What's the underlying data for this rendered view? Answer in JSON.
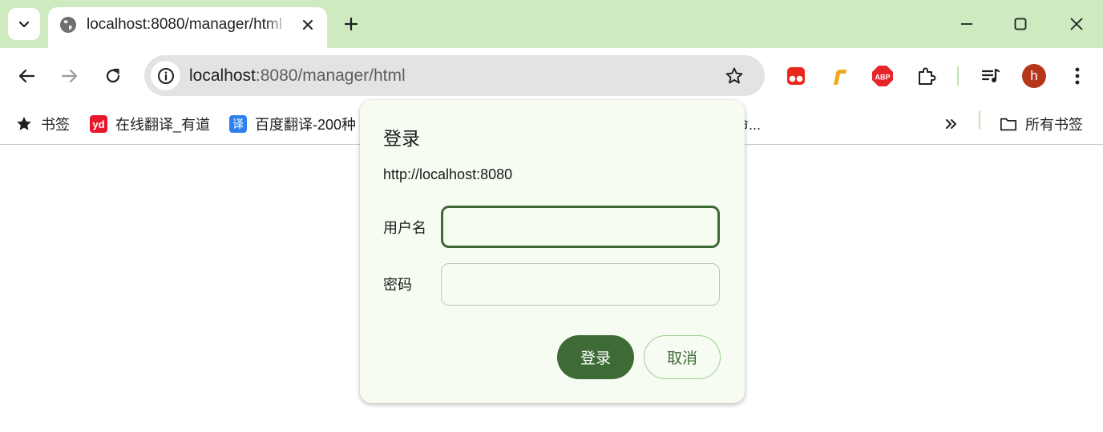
{
  "tab": {
    "title": "localhost:8080/manager/html",
    "close_icon": "close-icon",
    "favicon": "globe-icon"
  },
  "new_tab_symbol": "+",
  "address_bar": {
    "host": "localhost",
    "rest": ":8080/manager/html"
  },
  "avatar_letter": "h",
  "extensions": [
    "tampermonkey-icon",
    "pencil-extension-icon",
    "adblock-plus-icon",
    "puzzle-icon",
    "media-queue-icon"
  ],
  "bookmarks": {
    "star_label": "书签",
    "items": [
      {
        "label": "在线翻译_有道",
        "icon_text": "yd",
        "icon_color": "#e8172c"
      },
      {
        "label": "百度翻译-200种",
        "icon_text": "译",
        "icon_color": "#2f80ed"
      }
    ],
    "hidden_fragment": "命...",
    "all_bookmarks_label": "所有书签"
  },
  "dialog": {
    "title": "登录",
    "origin": "http://localhost:8080",
    "username_label": "用户名",
    "username_value": "",
    "password_label": "密码",
    "password_value": "",
    "login_button": "登录",
    "cancel_button": "取消"
  },
  "colors": {
    "titlebar": "#cdeac0",
    "accent": "#3d6a35",
    "dialog_bg": "#f7fcf2"
  }
}
